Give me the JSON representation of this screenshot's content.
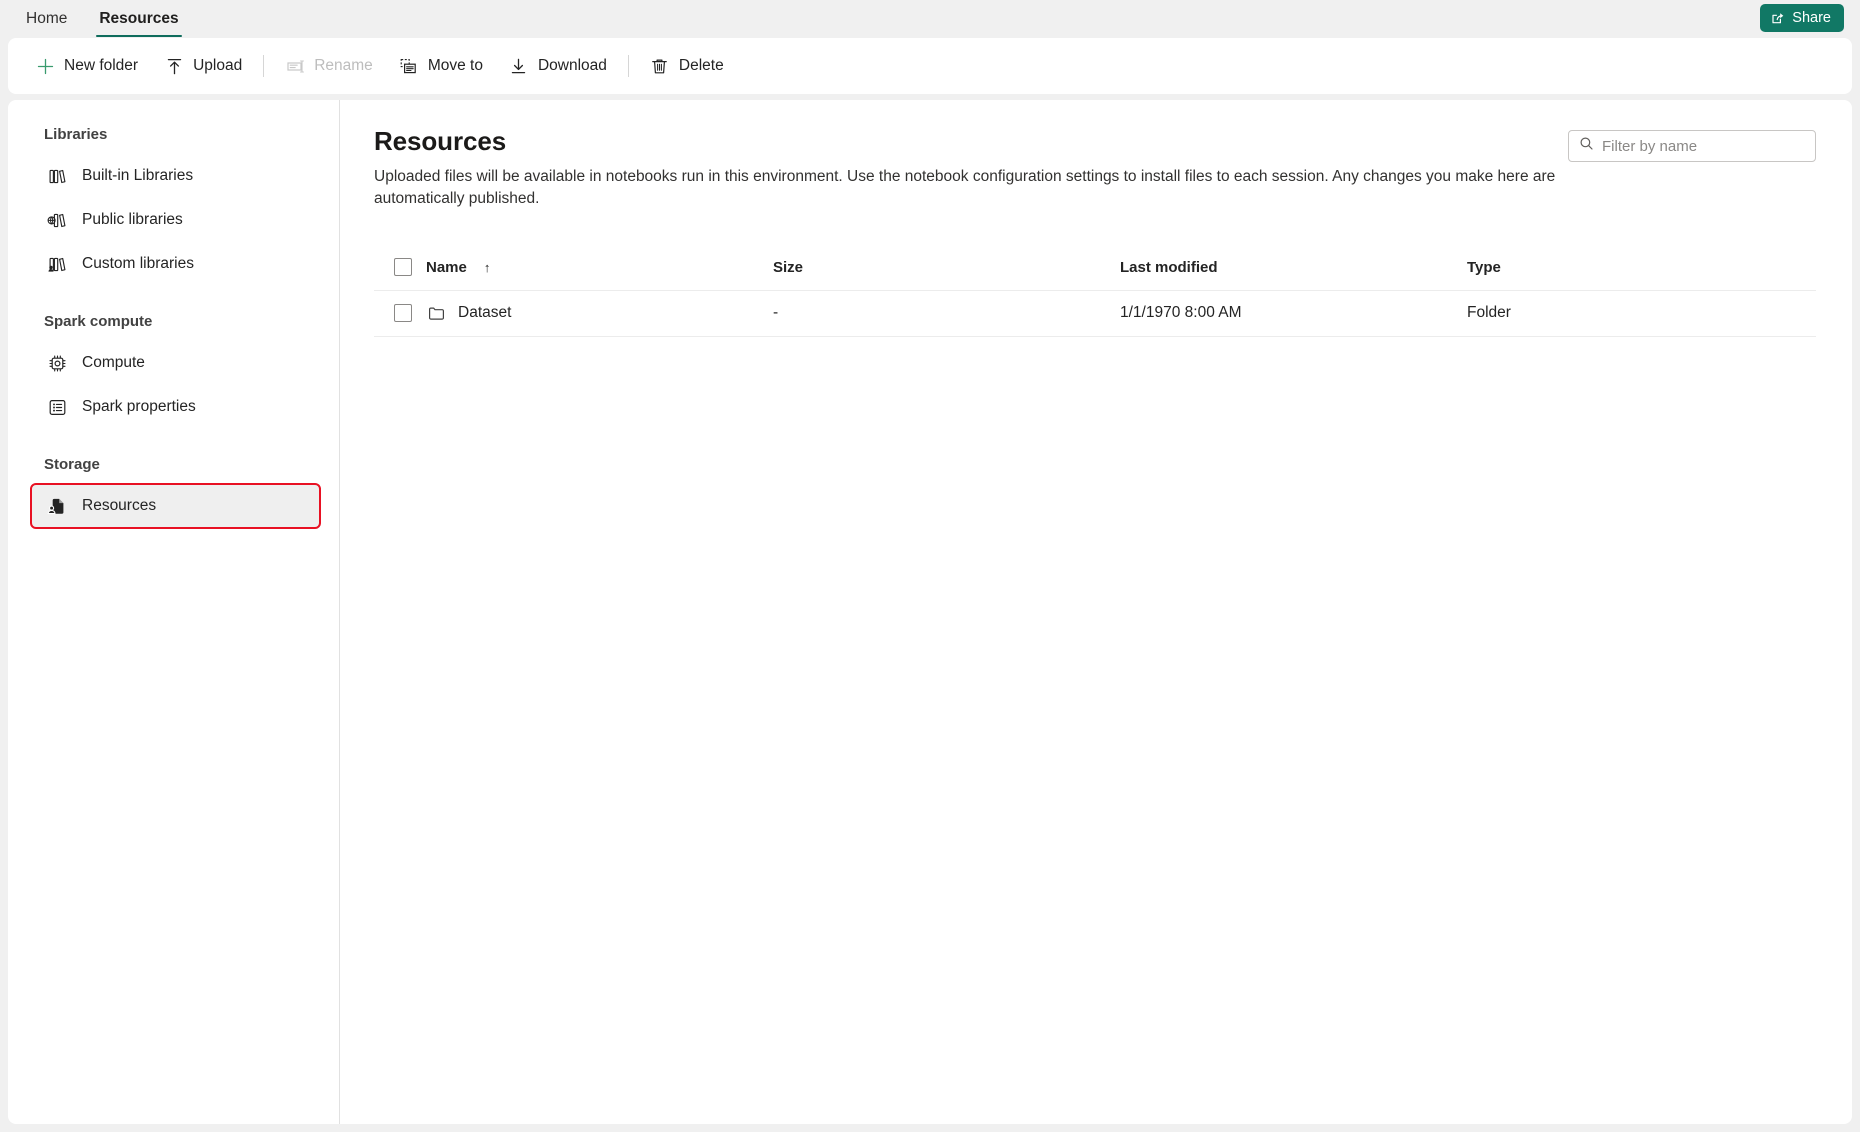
{
  "topbar": {
    "tabs": [
      {
        "label": "Home",
        "active": false
      },
      {
        "label": "Resources",
        "active": true
      }
    ],
    "share": {
      "label": "Share",
      "icon": "share-icon",
      "color": "#117865"
    }
  },
  "commandbar": {
    "items": [
      {
        "label": "New folder",
        "icon": "plus-icon",
        "disabled": false
      },
      {
        "label": "Upload",
        "icon": "upload-arrow-icon",
        "disabled": false
      },
      {
        "label": "Rename",
        "icon": "rename-icon",
        "disabled": true
      },
      {
        "label": "Move to",
        "icon": "move-to-icon",
        "disabled": false
      },
      {
        "label": "Download",
        "icon": "download-arrow-icon",
        "disabled": false
      },
      {
        "label": "Delete",
        "icon": "trash-icon",
        "disabled": false
      }
    ]
  },
  "sidebar": {
    "groups": [
      {
        "title": "Libraries",
        "items": [
          {
            "label": "Built-in Libraries",
            "icon": "books-icon",
            "selected": false
          },
          {
            "label": "Public libraries",
            "icon": "books-globe-icon",
            "selected": false
          },
          {
            "label": "Custom libraries",
            "icon": "books-person-icon",
            "selected": false
          }
        ]
      },
      {
        "title": "Spark compute",
        "items": [
          {
            "label": "Compute",
            "icon": "cpu-chip-icon",
            "selected": false
          },
          {
            "label": "Spark properties",
            "icon": "list-properties-icon",
            "selected": false
          }
        ]
      },
      {
        "title": "Storage",
        "items": [
          {
            "label": "Resources",
            "icon": "resource-file-icon",
            "selected": true
          }
        ]
      }
    ],
    "highlight_color": "#e81123"
  },
  "main": {
    "title": "Resources",
    "description": "Uploaded files will be available in notebooks run in this environment. Use the notebook configuration settings to install files to each session. Any changes you make here are automatically published.",
    "filter": {
      "placeholder": "Filter by name",
      "value": "",
      "icon": "search-icon"
    },
    "table": {
      "columns": [
        {
          "key": "name",
          "label": "Name",
          "sorted": true,
          "sort_dir": "ascending",
          "sort_glyph": "↑"
        },
        {
          "key": "size",
          "label": "Size"
        },
        {
          "key": "modified",
          "label": "Last modified"
        },
        {
          "key": "type",
          "label": "Type"
        }
      ],
      "select_all_checked": false,
      "rows": [
        {
          "checked": false,
          "icon": "folder-icon",
          "name": "Dataset",
          "size": "-",
          "modified": "1/1/1970 8:00 AM",
          "type": "Folder"
        }
      ]
    }
  }
}
